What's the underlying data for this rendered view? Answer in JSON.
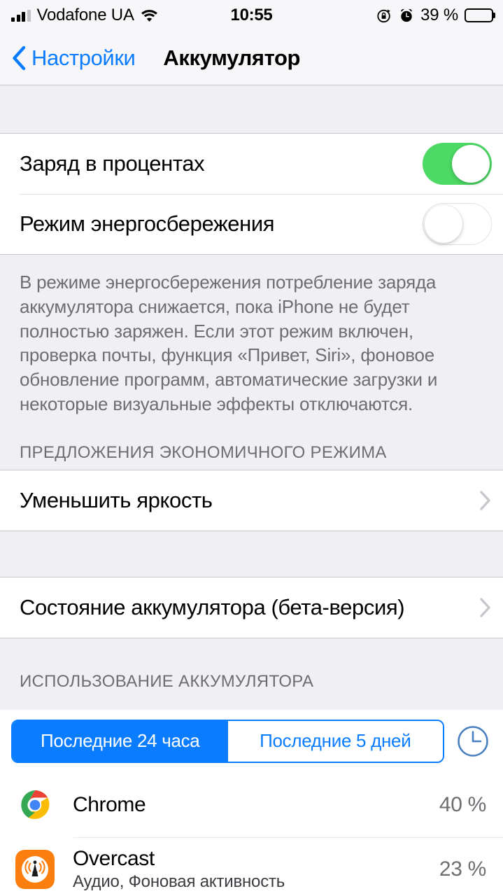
{
  "status_bar": {
    "carrier": "Vodafone UA",
    "time": "10:55",
    "battery_percent_label": "39 %",
    "battery_level": 39,
    "signal_bars_filled": 3,
    "signal_bars_total": 4,
    "icons": [
      "signal-bars-icon",
      "wifi-icon",
      "rotation-lock-icon",
      "alarm-clock-icon",
      "battery-icon"
    ]
  },
  "nav_bar": {
    "back_label": "Настройки",
    "title": "Аккумулятор"
  },
  "toggles": [
    {
      "label": "Заряд в процентах",
      "state": "on"
    },
    {
      "label": "Режим энергосбережения",
      "state": "off"
    }
  ],
  "footnote": "В режиме энергосбережения потребление заряда аккумулятора снижается, пока iPhone не будет полностью заряжен. Если этот режим включен, проверка почты, функция «Привет, Siri», фоновое обновление программ, автоматические загрузки и некоторые визуальные эффекты отключаются.",
  "suggestions": {
    "header": "ПРЕДЛОЖЕНИЯ ЭКОНОМИЧНОГО РЕЖИМА",
    "items": [
      {
        "label": "Уменьшить яркость"
      }
    ]
  },
  "battery_health": {
    "label": "Состояние аккумулятора (бета-версия)"
  },
  "usage": {
    "header": "ИСПОЛЬЗОВАНИЕ АККУМУЛЯТОРА",
    "segments": [
      {
        "label": "Последние 24 часа",
        "selected": true
      },
      {
        "label": "Последние 5 дней",
        "selected": false
      }
    ],
    "apps": [
      {
        "name": "Chrome",
        "subtitle": "",
        "percent": "40 %",
        "icon": "chrome-icon"
      },
      {
        "name": "Overcast",
        "subtitle": "Аудио, Фоновая активность",
        "percent": "23 %",
        "icon": "overcast-icon"
      }
    ]
  },
  "colors": {
    "accent_blue": "#0a7cff",
    "toggle_on_green": "#4cd964",
    "group_background": "#efeff4",
    "secondary_text": "#6d6d72"
  }
}
